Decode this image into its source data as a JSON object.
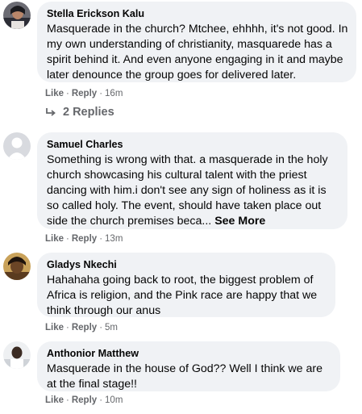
{
  "comments": [
    {
      "author": "Stella Erickson Kalu",
      "text": "Masquerade in the church? Mtchee, ehhhh, it's not good. In my own understanding of christianity, masquaredе has a spirit behind it. And even anyone engaging in it and maybe later denounce the group goes for delivered later.",
      "like": "Like",
      "reply": "Reply",
      "time": "16m",
      "replies_count": "2",
      "replies_label": "Replies"
    },
    {
      "author": "Samuel Charles",
      "text": "Something is wrong with that. a masquerade in the holy church showcasing his cultural talent with the priest dancing with him.i don't see any sign of holiness as it is so called holy. The event, should have taken place out side the church premises beca...",
      "see_more": "See More",
      "like": "Like",
      "reply": "Reply",
      "time": "13m"
    },
    {
      "author": "Gladys Nkechi",
      "text": "Hahahaha going back to root, the biggest problem of Africa is religion, and the Pink race are happy that we think through our anus",
      "like": "Like",
      "reply": "Reply",
      "time": "5m"
    },
    {
      "author": "Anthonior Matthew",
      "text": "Masquerade in the house of God?? Well I think we are at the final stage!!",
      "like": "Like",
      "reply": "Reply",
      "time": "10m"
    }
  ],
  "separator": "·",
  "colors": {
    "bubble": "#f0f2f5",
    "meta": "#65676b",
    "text": "#050505"
  }
}
